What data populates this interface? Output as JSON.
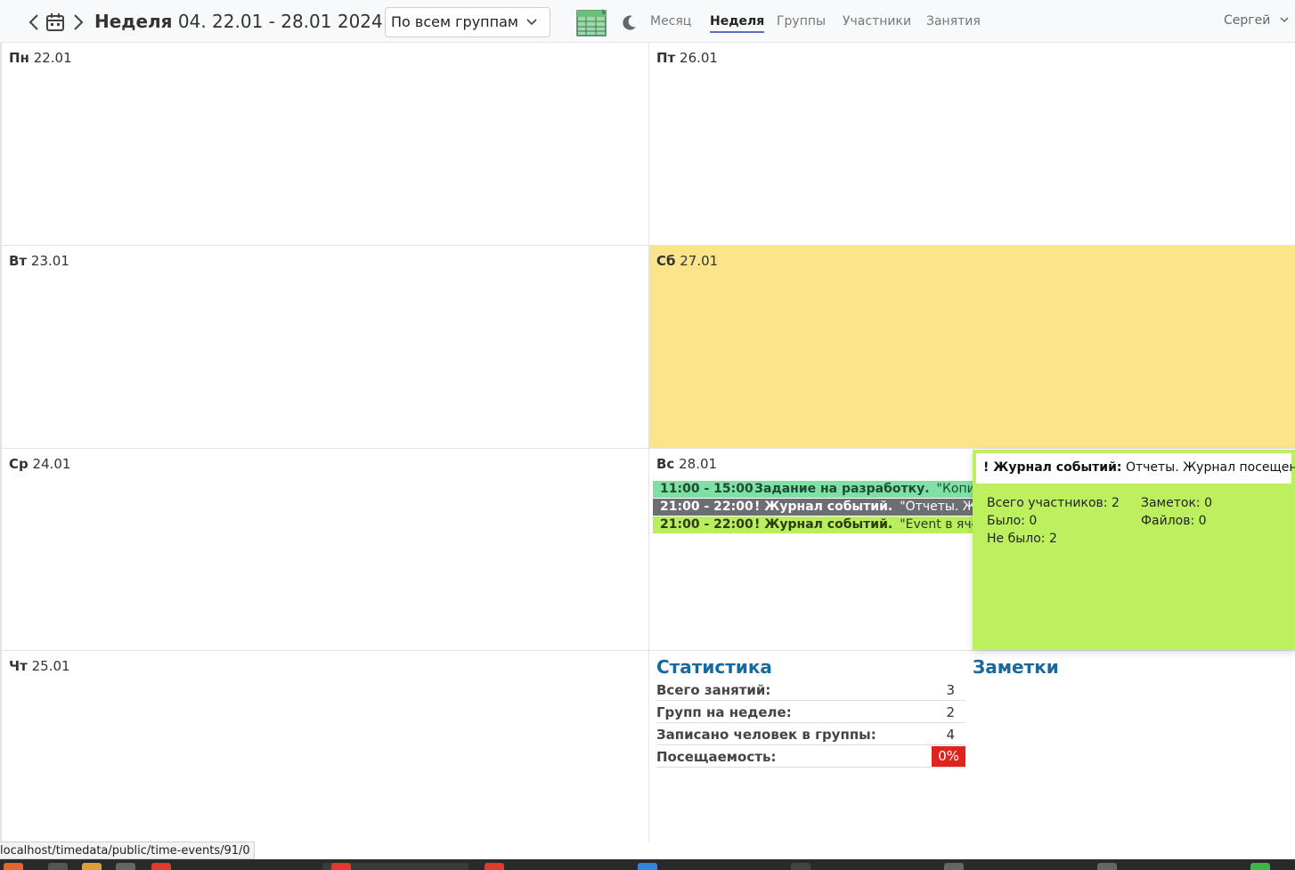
{
  "header": {
    "week_prefix": "Неделя",
    "week_range": "04. 22.01 - 28.01 2024",
    "group_filter": "По всем группам",
    "menu": [
      {
        "label": "Месяц",
        "active": false
      },
      {
        "label": "Неделя",
        "active": true
      },
      {
        "label": "Группы",
        "active": false
      },
      {
        "label": "Участники",
        "active": false
      },
      {
        "label": "Занятия",
        "active": false
      }
    ],
    "user": "Сергей"
  },
  "days": [
    {
      "abbr": "Пн",
      "date": "22.01"
    },
    {
      "abbr": "Вт",
      "date": "23.01"
    },
    {
      "abbr": "Ср",
      "date": "24.01"
    },
    {
      "abbr": "Чт",
      "date": "25.01"
    },
    {
      "abbr": "Пт",
      "date": "26.01"
    },
    {
      "abbr": "Сб",
      "date": "27.01"
    },
    {
      "abbr": "Вс",
      "date": "28.01"
    }
  ],
  "events": [
    {
      "time": "11:00 - 15:00",
      "name": "Задание на разработку.",
      "desc": "\"Копирован",
      "color": "#7fe0a6"
    },
    {
      "time": "21:00 - 22:00",
      "name": "! Журнал событий.",
      "desc": "\"Отчеты. Журнал",
      "color": "#6b6e73"
    },
    {
      "time": "21:00 - 22:00",
      "name": "! Журнал событий.",
      "desc": "\"Event в ячейках",
      "color": "#b9ef5f"
    }
  ],
  "popup": {
    "title": "! Журнал событий:",
    "subtitle": "Отчеты. Журнал посещений",
    "total_participants": "Всего участников: 2",
    "attended": "Было: 0",
    "absent": "Не было: 2",
    "notes": "Заметок: 0",
    "files": "Файлов: 0"
  },
  "statistics": {
    "title": "Статистика",
    "rows": [
      {
        "label": "Всего занятий:",
        "value": "3"
      },
      {
        "label": "Групп на неделе:",
        "value": "2"
      },
      {
        "label": "Записано человек в группы:",
        "value": "4"
      },
      {
        "label": "Посещаемость:",
        "value": "0%"
      }
    ]
  },
  "notes": {
    "title": "Заметки"
  },
  "status_url": "localhost/timedata/public/time-events/91/0",
  "colors": {
    "saturday": "#fbe48a",
    "accent": "#17699e",
    "badge": "#e0241c",
    "popup": "#bdf05e"
  }
}
